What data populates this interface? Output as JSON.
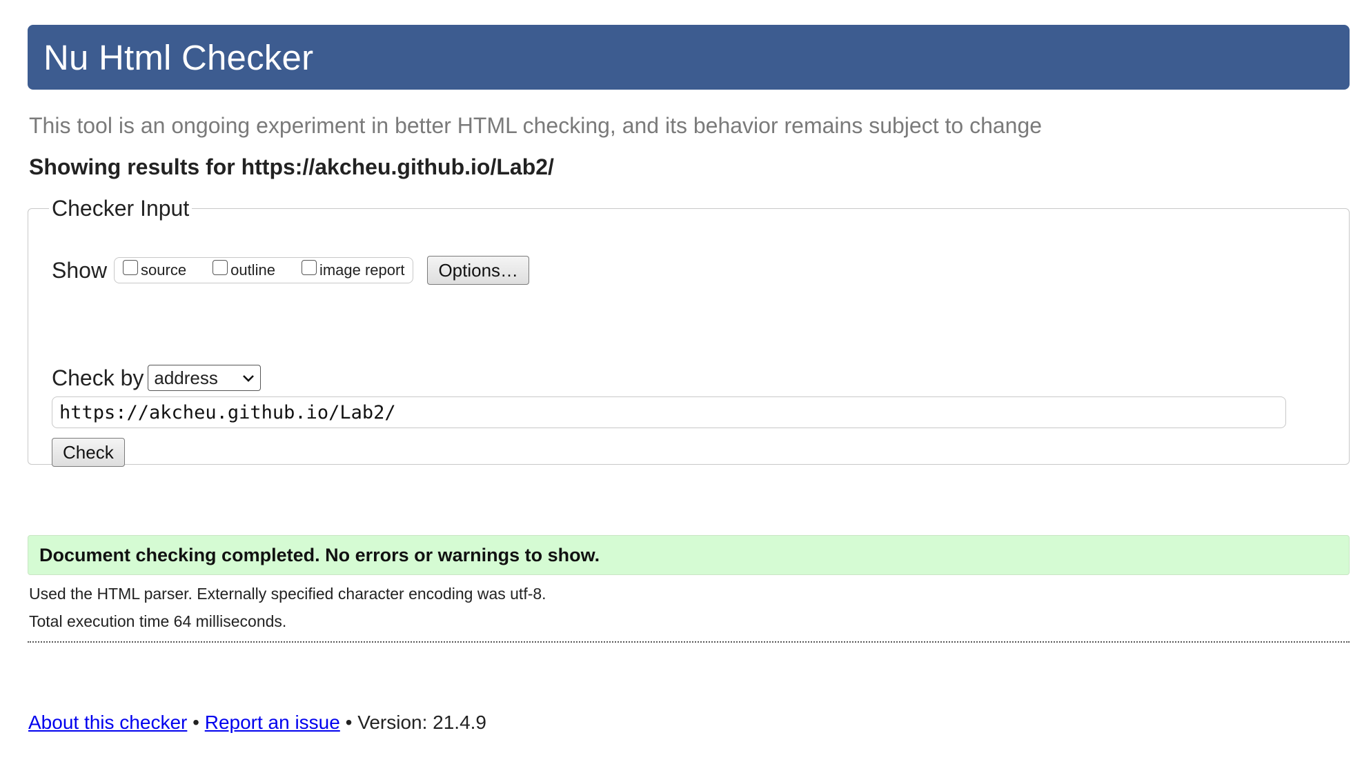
{
  "header": {
    "title": "Nu Html Checker"
  },
  "subtitle": "This tool is an ongoing experiment in better HTML checking, and its behavior remains subject to change",
  "results_for": "Showing results for https://akcheu.github.io/Lab2/",
  "checker_input": {
    "legend": "Checker Input",
    "show_label": "Show",
    "show_options": [
      {
        "label": "source",
        "checked": false
      },
      {
        "label": "outline",
        "checked": false
      },
      {
        "label": "image report",
        "checked": false
      }
    ],
    "options_button": "Options…",
    "check_by_label": "Check by",
    "check_by_value": "address",
    "url_value": "https://akcheu.github.io/Lab2/",
    "check_button": "Check"
  },
  "result": {
    "message": "Document checking completed. No errors or warnings to show.",
    "parser_info": "Used the HTML parser. Externally specified character encoding was utf-8.",
    "execution_time": "Total execution time 64 milliseconds."
  },
  "footer": {
    "about_link": "About this checker",
    "separator": "•",
    "report_link": "Report an issue",
    "version": "Version: 21.4.9"
  },
  "colors": {
    "banner": "#3d5c90",
    "success_bg": "#d5fbd3",
    "link": "#0000ee"
  }
}
